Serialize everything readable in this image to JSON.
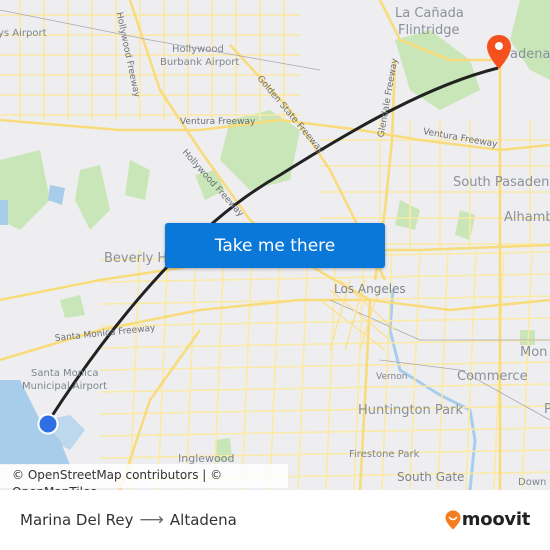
{
  "map": {
    "labels": {
      "airport_nw": "ys Airport",
      "burbank_airport_line1": "Hollywood",
      "burbank_airport_line2": "Burbank Airport",
      "la_canada_line1": "La Cañada",
      "la_canada_line2": "Flintridge",
      "altadena_partial": "adena",
      "south_pasadena": "South Pasaden",
      "alhambra": "Alhamb",
      "beverly_hills": "Beverly H",
      "los_angeles": "Los Angeles",
      "santa_monica_airport_line1": "Santa Monica",
      "santa_monica_airport_line2": "Municipal Airport",
      "vernon": "Vernon",
      "commerce": "Commerce",
      "monterey_partial": "Mon",
      "huntington_park": "Huntington Park",
      "firestone_park": "Firestone Park",
      "inglewood": "Inglewood",
      "south_gate": "South Gate",
      "downey_partial": "Down",
      "pico_partial": "P"
    },
    "roads": {
      "hollywood_freeway_north": "Hollywood Freeway",
      "golden_state_freeway": "Golden State Freeway",
      "ventura_freeway_west": "Ventura Freeway",
      "ventura_freeway_east": "Ventura Freeway",
      "glendale_freeway": "Glendale Freeway",
      "hollywood_freeway_south": "Hollywood Freeway",
      "santa_monica_freeway": "Santa Monica Freeway"
    },
    "origin_marker": {
      "name": "Marina Del Rey",
      "color": "#2f6fe4"
    },
    "destination_marker": {
      "name": "Altadena",
      "color": "#f4511e"
    },
    "route_color": "#222222",
    "cta_button": {
      "label": "Take me there",
      "color": "#0a78d8"
    },
    "attribution": "© OpenStreetMap contributors | © OpenMapTiles"
  },
  "footer": {
    "origin": "Marina Del Rey",
    "arrow": "⟶",
    "destination": "Altadena",
    "logo_text": "moovit",
    "logo_color": "#f47d20"
  }
}
